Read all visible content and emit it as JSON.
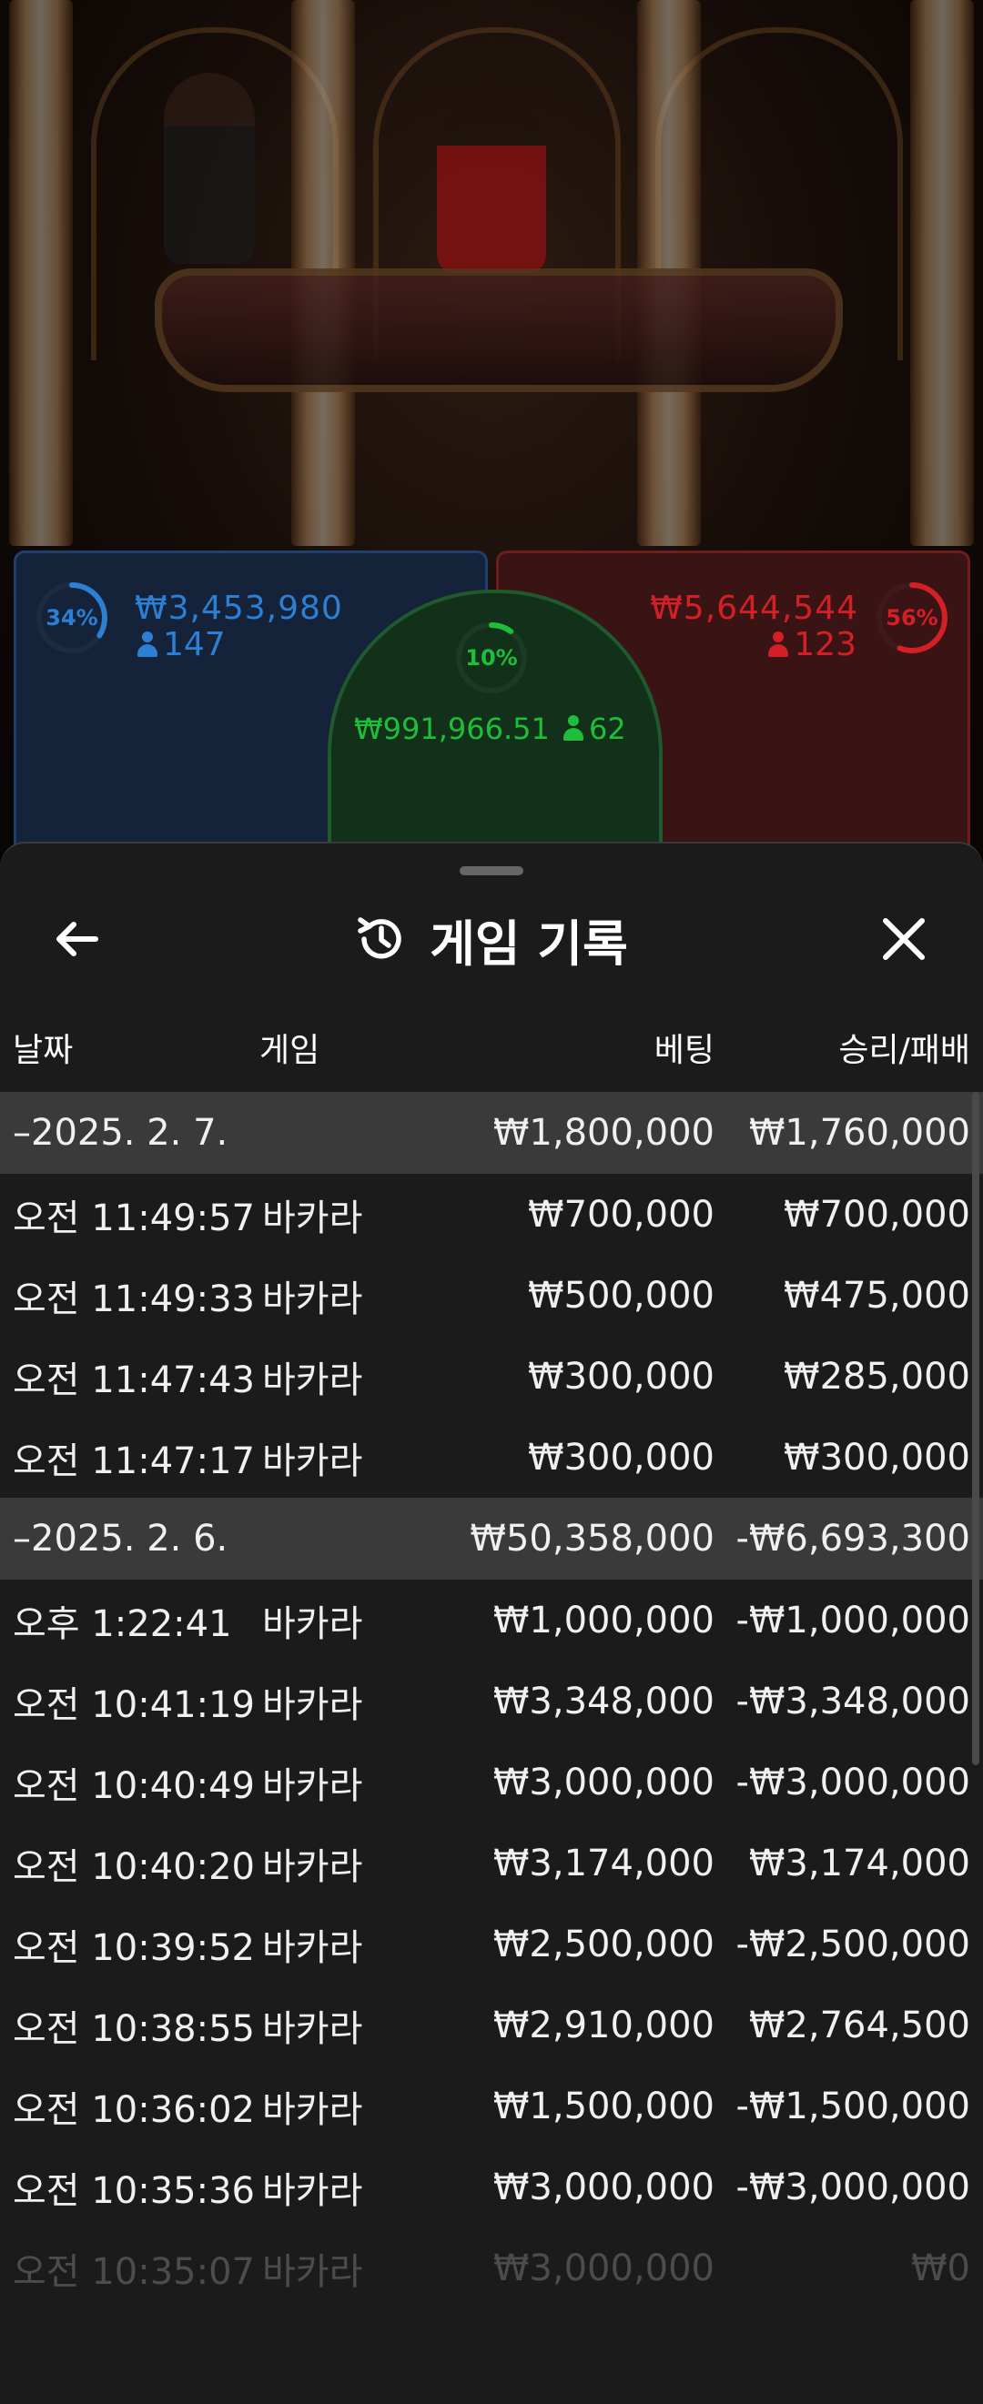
{
  "bets": {
    "player": {
      "percent": 34,
      "percent_label": "34%",
      "amount": "₩3,453,980",
      "players": "147",
      "color": "#2d7fd3"
    },
    "banker": {
      "percent": 56,
      "percent_label": "56%",
      "amount": "₩5,644,544",
      "players": "123",
      "color": "#d31f26"
    },
    "tie": {
      "percent": 10,
      "percent_label": "10%",
      "amount": "₩991,966.51",
      "players": "62",
      "color": "#1fbe3a"
    }
  },
  "history": {
    "title": "게임 기록",
    "back_icon": "arrow-left-icon",
    "history_icon": "history-clock-icon",
    "close_icon": "close-icon",
    "columns": {
      "date": "날짜",
      "game": "게임",
      "bet": "베팅",
      "result": "승리/패배"
    },
    "groups": [
      {
        "date": "–2025. 2. 7.",
        "bet": "₩1,800,000",
        "result": "₩1,760,000",
        "rows": [
          {
            "time": "오전 11:49:57",
            "game": "바카라",
            "bet": "₩700,000",
            "result": "₩700,000"
          },
          {
            "time": "오전 11:49:33",
            "game": "바카라",
            "bet": "₩500,000",
            "result": "₩475,000"
          },
          {
            "time": "오전 11:47:43",
            "game": "바카라",
            "bet": "₩300,000",
            "result": "₩285,000"
          },
          {
            "time": "오전 11:47:17",
            "game": "바카라",
            "bet": "₩300,000",
            "result": "₩300,000"
          }
        ]
      },
      {
        "date": "–2025. 2. 6.",
        "bet": "₩50,358,000",
        "result": "-₩6,693,300",
        "rows": [
          {
            "time": "오후 1:22:41",
            "game": "바카라",
            "bet": "₩1,000,000",
            "result": "-₩1,000,000"
          },
          {
            "time": "오전 10:41:19",
            "game": "바카라",
            "bet": "₩3,348,000",
            "result": "-₩3,348,000"
          },
          {
            "time": "오전 10:40:49",
            "game": "바카라",
            "bet": "₩3,000,000",
            "result": "-₩3,000,000"
          },
          {
            "time": "오전 10:40:20",
            "game": "바카라",
            "bet": "₩3,174,000",
            "result": "₩3,174,000"
          },
          {
            "time": "오전 10:39:52",
            "game": "바카라",
            "bet": "₩2,500,000",
            "result": "-₩2,500,000"
          },
          {
            "time": "오전 10:38:55",
            "game": "바카라",
            "bet": "₩2,910,000",
            "result": "₩2,764,500"
          },
          {
            "time": "오전 10:36:02",
            "game": "바카라",
            "bet": "₩1,500,000",
            "result": "-₩1,500,000"
          },
          {
            "time": "오전 10:35:36",
            "game": "바카라",
            "bet": "₩3,000,000",
            "result": "-₩3,000,000"
          },
          {
            "time": "오전 10:35:07",
            "game": "바카라",
            "bet": "₩3,000,000",
            "result": "₩0"
          }
        ]
      }
    ]
  }
}
